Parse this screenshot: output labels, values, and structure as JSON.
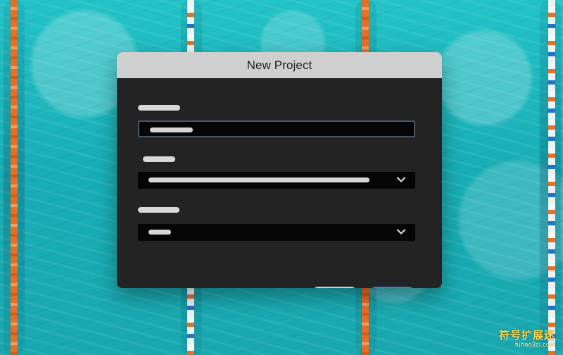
{
  "window": {
    "title": "New Project"
  },
  "form": {
    "project_name": {
      "value": ""
    },
    "dropdown_1": {
      "selected": ""
    },
    "dropdown_2": {
      "selected": ""
    }
  },
  "icons": {
    "dropdown_1": "chevron-down-icon",
    "dropdown_2": "chevron-down-icon",
    "settings": "gear-icon"
  },
  "colors": {
    "dialog_background": "#232323",
    "title_bar": "#cfcfcf",
    "primary_button": "#3c79d8"
  },
  "watermark": {
    "line1": "符号扩展迷",
    "line2": "fuhao3zi.com"
  }
}
